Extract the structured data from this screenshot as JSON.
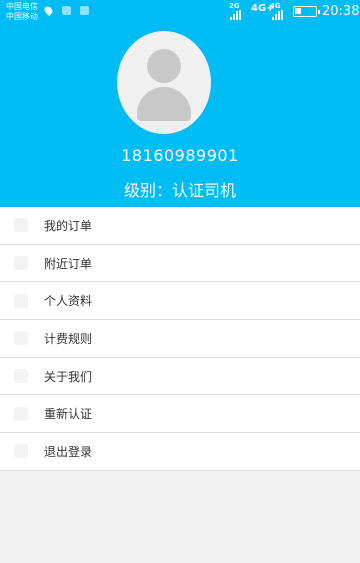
{
  "status_bar": {
    "carrier_1": "中国电信",
    "carrier_2": "中国移动",
    "network_1": "2G",
    "network_2": "4G+",
    "network_3": "4G",
    "battery_level_percent": 30,
    "time": "20:38"
  },
  "profile": {
    "phone": "18160989901",
    "level": "级别：认证司机"
  },
  "menu": {
    "items": [
      {
        "label": "我的订单",
        "icon": "orders-icon"
      },
      {
        "label": "附近订单",
        "icon": "nearby-icon"
      },
      {
        "label": "个人资料",
        "icon": "profile-icon"
      },
      {
        "label": "计费规则",
        "icon": "billing-icon"
      },
      {
        "label": "关于我们",
        "icon": "about-icon"
      },
      {
        "label": "重新认证",
        "icon": "reauth-icon"
      },
      {
        "label": "退出登录",
        "icon": "logout-icon"
      }
    ]
  },
  "colors": {
    "header": "#00bcf5",
    "background": "#f2f2f2"
  }
}
